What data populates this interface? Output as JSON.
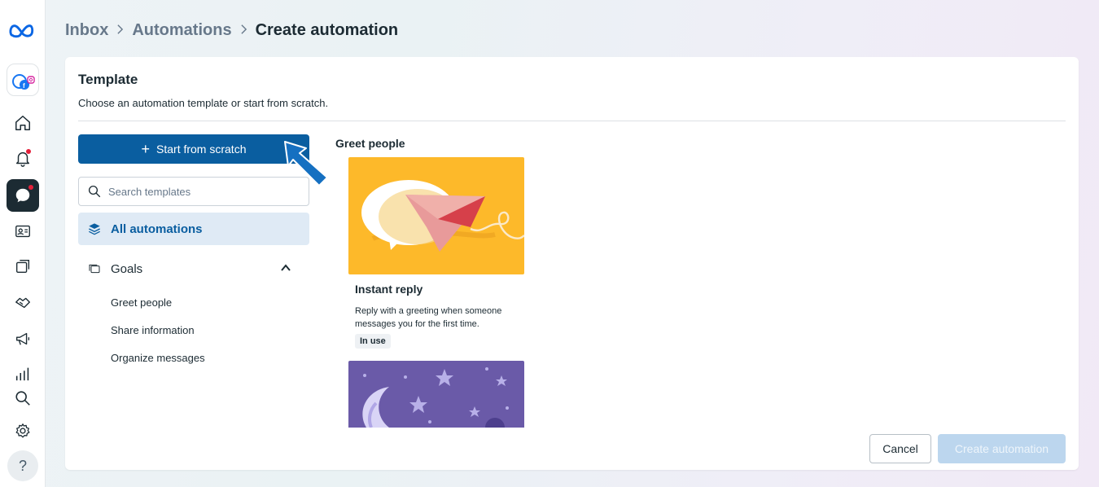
{
  "breadcrumb": {
    "items": [
      "Inbox",
      "Automations",
      "Create automation"
    ]
  },
  "rail": {
    "items": [
      "meta-logo",
      "account",
      "home",
      "notifications",
      "inbox",
      "contacts",
      "content",
      "deals",
      "ads",
      "insights",
      "search",
      "settings",
      "help"
    ],
    "help_label": "?"
  },
  "template": {
    "title": "Template",
    "subtitle": "Choose an automation template or start from scratch.",
    "start_label": "Start from scratch",
    "search_placeholder": "Search templates",
    "all_label": "All automations",
    "goals_label": "Goals",
    "goal_items": [
      "Greet people",
      "Share information",
      "Organize messages"
    ]
  },
  "section": {
    "title": "Greet people",
    "cards": [
      {
        "name": "Instant reply",
        "description": "Reply with a greeting when someone messages you for the first time.",
        "badge": "In use"
      }
    ]
  },
  "footer": {
    "cancel_label": "Cancel",
    "create_label": "Create automation"
  },
  "colors": {
    "primary": "#0a5ea0",
    "primary_disabled": "#bcd6ee",
    "selected_bg": "#dfeaf5",
    "card_yellow": "#fdb92a",
    "card_purple": "#6a5aa8",
    "notification_dot": "#e4203a"
  }
}
